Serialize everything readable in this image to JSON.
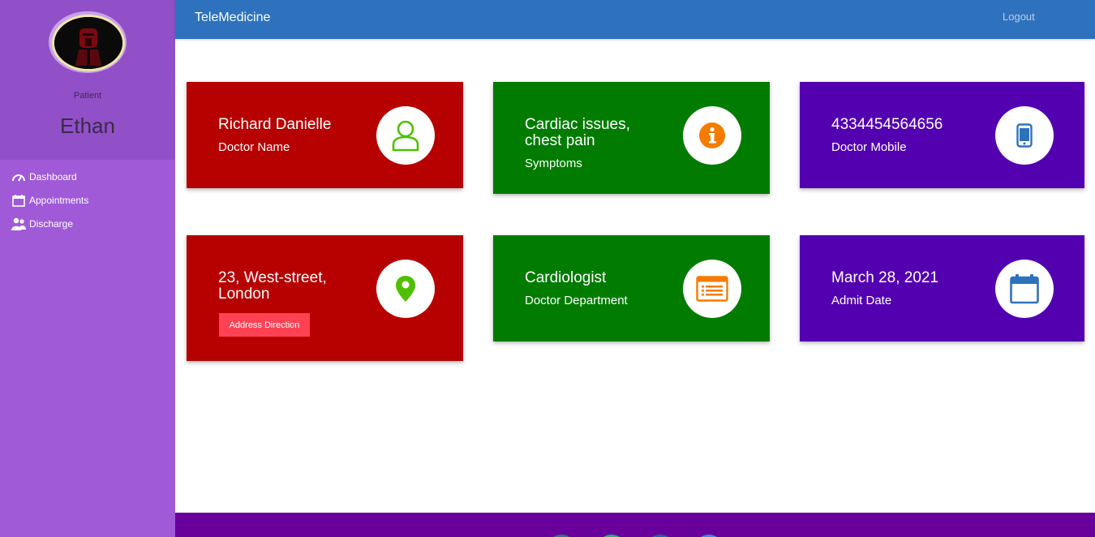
{
  "sidebar": {
    "role": "Patient",
    "name": "Ethan",
    "items": [
      {
        "label": "Dashboard",
        "icon": "speedometer-icon"
      },
      {
        "label": "Appointments",
        "icon": "calendar-icon"
      },
      {
        "label": "Discharge",
        "icon": "users-icon"
      }
    ]
  },
  "header": {
    "brand": "TeleMedicine",
    "logout": "Logout"
  },
  "cards": {
    "doctor_name": {
      "value": "Richard Danielle",
      "label": "Doctor Name"
    },
    "symptoms": {
      "value": "Cardiac issues, chest pain",
      "label": "Symptoms"
    },
    "doctor_mobile": {
      "value": "4334454564656",
      "label": "Doctor Mobile"
    },
    "address": {
      "value": "23, West-street, London",
      "button": "Address Direction"
    },
    "department": {
      "value": "Cardiologist",
      "label": "Doctor Department"
    },
    "admit_date": {
      "value": "March 28, 2021",
      "label": "Admit Date"
    }
  },
  "colors": {
    "red_card": "#b70000",
    "green_card": "#017c01",
    "purple_card": "#5300b0",
    "header": "#2e72bd",
    "sidebar": "#a05ad8",
    "footer": "#6a009c",
    "button": "#fe4254"
  }
}
